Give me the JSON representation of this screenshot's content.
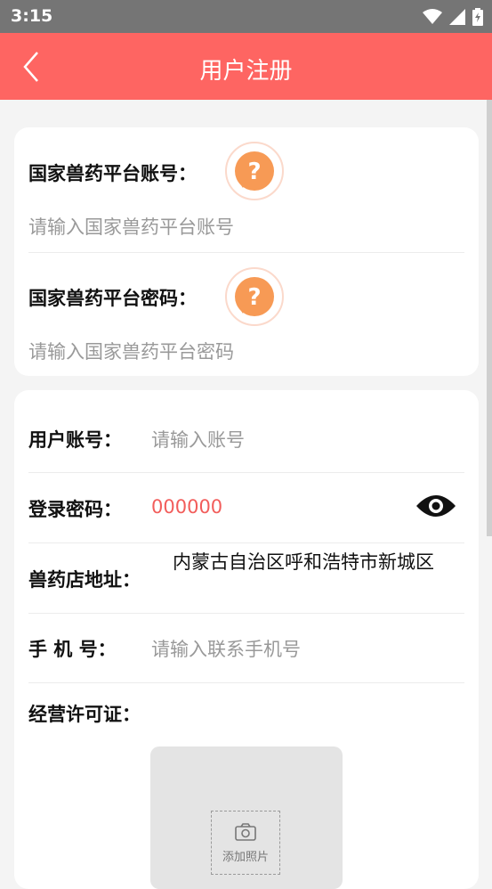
{
  "status_bar": {
    "time": "3:15",
    "icons": [
      "wifi-icon",
      "signal-icon",
      "battery-icon"
    ]
  },
  "header": {
    "title": "用户注册",
    "back_icon": "chevron-left-icon"
  },
  "platform": {
    "account_label": "国家兽药平台账号：",
    "account_placeholder": "请输入国家兽药平台账号",
    "password_label": "国家兽药平台密码：",
    "password_placeholder": "请输入国家兽药平台密码"
  },
  "form": {
    "account_label": "用户账号：",
    "account_placeholder": "请输入账号",
    "password_label": "登录密码：",
    "password_value": "000000",
    "address_label": "兽药店地址：",
    "address_value": "内蒙古自治区呼和浩特市新城区",
    "phone_label": "手 机 号：",
    "phone_placeholder": "请输入联系手机号",
    "license_label": "经营许可证：",
    "add_photo_label": "添加照片"
  },
  "colors": {
    "accent": "#fe6562",
    "password_text": "#f25d5b",
    "help_icon": "#f79a55"
  }
}
